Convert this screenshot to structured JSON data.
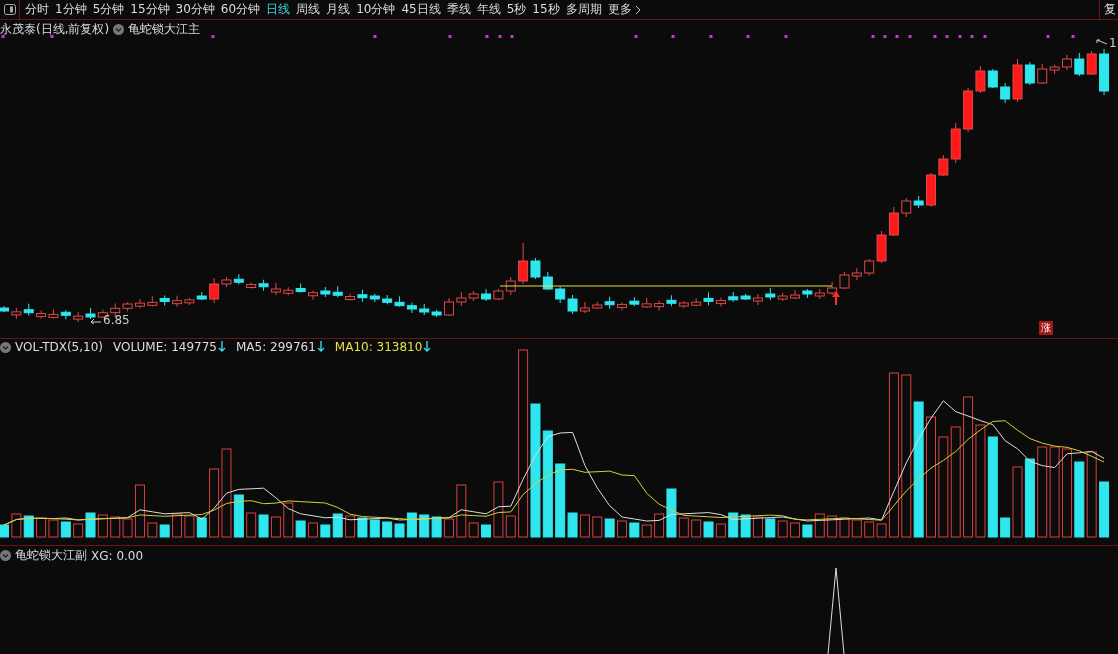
{
  "toolbar": {
    "tabs": [
      {
        "label": "分时",
        "selected": false
      },
      {
        "label": "1分钟",
        "selected": false
      },
      {
        "label": "5分钟",
        "selected": false
      },
      {
        "label": "15分钟",
        "selected": false
      },
      {
        "label": "30分钟",
        "selected": false
      },
      {
        "label": "60分钟",
        "selected": false
      },
      {
        "label": "日线",
        "selected": true
      },
      {
        "label": "周线",
        "selected": false
      },
      {
        "label": "月线",
        "selected": false
      },
      {
        "label": "10分钟",
        "selected": false
      },
      {
        "label": "45日线",
        "selected": false
      },
      {
        "label": "季线",
        "selected": false
      },
      {
        "label": "年线",
        "selected": false
      },
      {
        "label": "5秒",
        "selected": false
      },
      {
        "label": "15秒",
        "selected": false
      },
      {
        "label": "多周期",
        "selected": false
      }
    ],
    "more": "更多",
    "right_button": "复"
  },
  "main_panel": {
    "title": "永茂泰(日线,前复权)",
    "indicator": "龟蛇锁大江主",
    "low_label": "6.85",
    "high_label": "1",
    "badge": "涨"
  },
  "volume_panel": {
    "name": "VOL-TDX(5,10)",
    "readings": [
      {
        "label": "VOLUME: 149775",
        "color": "#dddddd",
        "falling": true
      },
      {
        "label": "MA5: 299761",
        "color": "#dddddd",
        "falling": true
      },
      {
        "label": "MA10: 313810",
        "color": "#e6e04a",
        "falling": true
      }
    ]
  },
  "signal_panel": {
    "name": "龟蛇锁大江副",
    "reading": "XG: 0.00"
  }
}
